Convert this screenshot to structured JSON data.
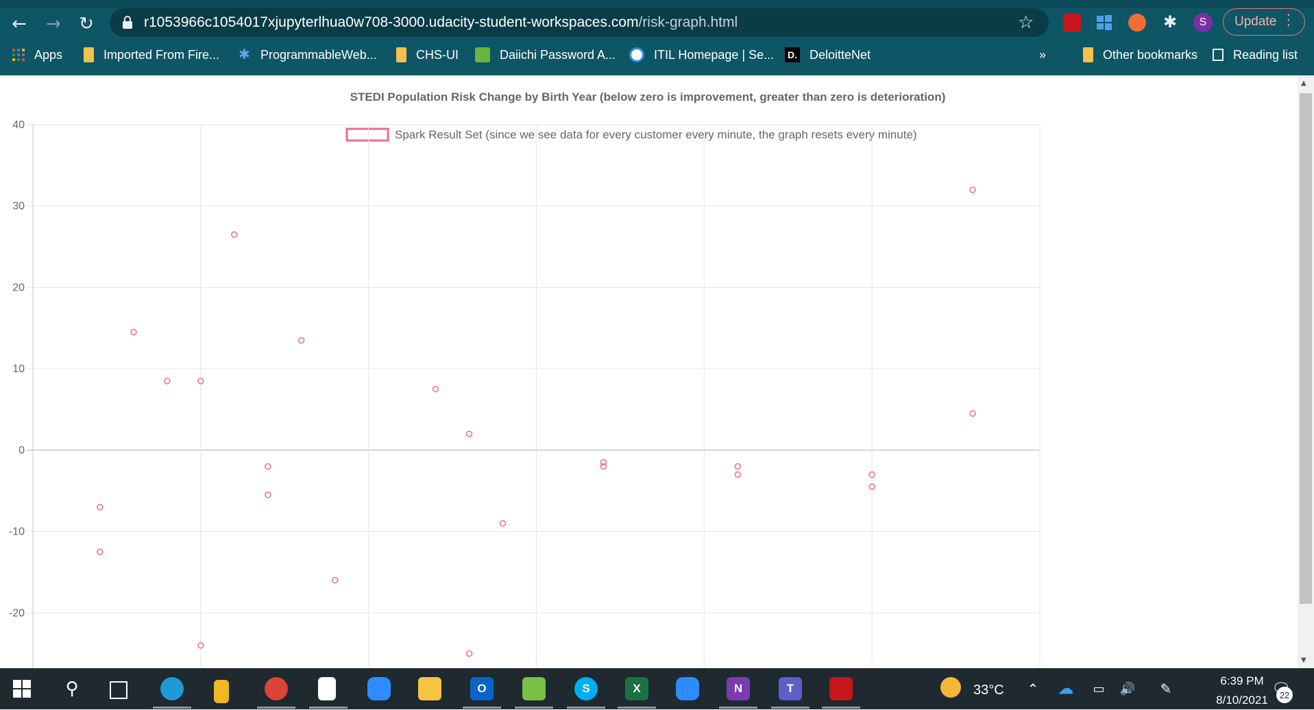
{
  "browser": {
    "url_host": "r1053966c1054017xjupyterlhua0w708-3000.udacity-student-workspaces.com",
    "url_path": "/risk-graph.html",
    "update_label": "Update",
    "profile_initial": "S",
    "bookmarks": [
      {
        "label": "Apps",
        "icon": "apps-grid-icon"
      },
      {
        "label": "Imported From Fire...",
        "icon": "folder-icon"
      },
      {
        "label": "ProgrammableWeb...",
        "icon": "puzzle-icon"
      },
      {
        "label": "CHS-UI",
        "icon": "folder-icon"
      },
      {
        "label": "Daiichi Password A...",
        "icon": "password-icon"
      },
      {
        "label": "ITIL Homepage | Se...",
        "icon": "itil-icon"
      },
      {
        "label": "DeloitteNet",
        "icon": "deloitte-icon"
      }
    ],
    "overflow_label": "»",
    "other_bookmarks": "Other bookmarks",
    "reading_list": "Reading list"
  },
  "chart_data": {
    "type": "scatter",
    "title": "STEDI Population Risk Change by Birth Year (below zero is improvement, greater than zero is deterioration)",
    "legend": "Spark Result Set (since we see data for every customer every minute, the graph resets every minute)",
    "legend_placement": "top",
    "series_color": "#f06a8a",
    "grid": true,
    "y_ticks": [
      40,
      30,
      20,
      10,
      0,
      -10,
      -20
    ],
    "ylim": [
      -26.8,
      40
    ],
    "xlim": [
      0,
      6
    ],
    "points": [
      {
        "x": 0.4,
        "y": -7
      },
      {
        "x": 0.4,
        "y": -12.5
      },
      {
        "x": 0.6,
        "y": 14.5
      },
      {
        "x": 0.8,
        "y": 8.5
      },
      {
        "x": 1.0,
        "y": 8.5
      },
      {
        "x": 1.0,
        "y": -24
      },
      {
        "x": 1.2,
        "y": 26.5
      },
      {
        "x": 1.4,
        "y": -2
      },
      {
        "x": 1.4,
        "y": -5.5
      },
      {
        "x": 1.6,
        "y": 13.5
      },
      {
        "x": 1.8,
        "y": -16
      },
      {
        "x": 2.4,
        "y": 7.5
      },
      {
        "x": 2.6,
        "y": 2
      },
      {
        "x": 2.6,
        "y": -25
      },
      {
        "x": 2.8,
        "y": -9
      },
      {
        "x": 3.4,
        "y": -1.5
      },
      {
        "x": 3.4,
        "y": -2
      },
      {
        "x": 4.2,
        "y": -2
      },
      {
        "x": 4.2,
        "y": -3
      },
      {
        "x": 5.0,
        "y": -3
      },
      {
        "x": 5.0,
        "y": -4.5
      },
      {
        "x": 5.6,
        "y": 32
      },
      {
        "x": 5.6,
        "y": 4.5
      }
    ]
  },
  "taskbar": {
    "apps": [
      {
        "name": "search-icon"
      },
      {
        "name": "task-view-icon"
      },
      {
        "name": "edge-icon"
      },
      {
        "name": "lock-app-icon"
      },
      {
        "name": "chrome-icon"
      },
      {
        "name": "notepad-icon"
      },
      {
        "name": "zoom-icon"
      },
      {
        "name": "file-explorer-icon"
      },
      {
        "name": "outlook-icon"
      },
      {
        "name": "paint-icon"
      },
      {
        "name": "skype-icon"
      },
      {
        "name": "excel-icon"
      },
      {
        "name": "zoom-meetings-icon"
      },
      {
        "name": "onenote-icon"
      },
      {
        "name": "teams-icon"
      },
      {
        "name": "acrobat-icon"
      }
    ],
    "temperature": "33°C",
    "time": "6:39 PM",
    "date": "8/10/2021",
    "notifications": "22"
  }
}
